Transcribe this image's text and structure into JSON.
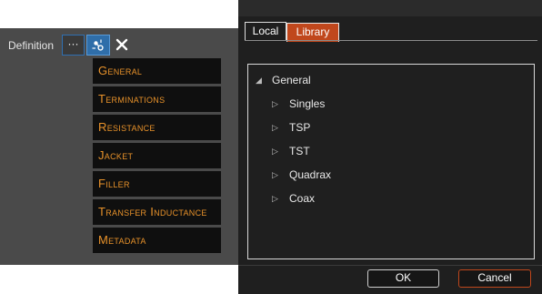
{
  "left_panel": {
    "definition_label": "Definition",
    "more_button_label": "···",
    "settings_icon": "wrench-cog-icon",
    "close_icon": "close-icon",
    "sections": [
      "General",
      "Terminations",
      "Resistance",
      "Jacket",
      "Filler",
      "Transfer Inductance",
      "Metadata"
    ],
    "colors": {
      "panel_bg": "#4a4a4a",
      "section_bg": "#0f0f0f",
      "section_text": "#e8922a",
      "accent_blue": "#2f6ea9"
    }
  },
  "dialog": {
    "tabs": [
      "Local",
      "Library"
    ],
    "active_tab": "Library",
    "tree": {
      "root": "General",
      "root_expanded": true,
      "children": [
        "Singles",
        "TSP",
        "TST",
        "Quadrax",
        "Coax"
      ]
    },
    "ok_label": "OK",
    "cancel_label": "Cancel",
    "colors": {
      "dialog_bg": "#1f1f1f",
      "accent_orange": "#c0471c"
    }
  }
}
